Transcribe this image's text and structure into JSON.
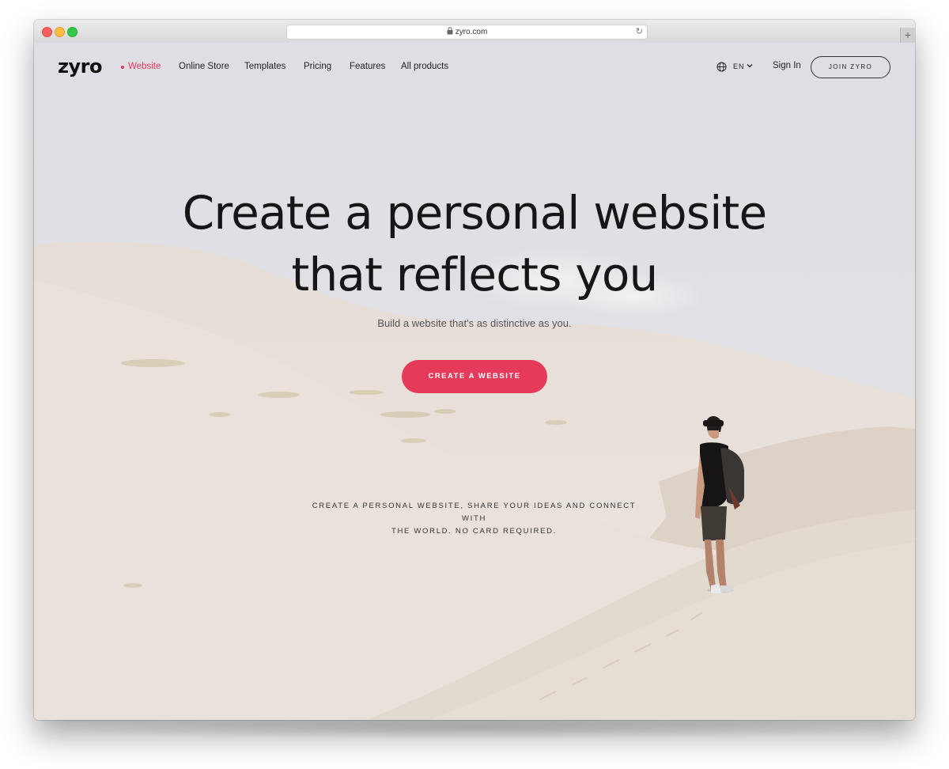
{
  "browser": {
    "url": "zyro.com",
    "new_tab_label": "+"
  },
  "nav": {
    "logo": "zyro",
    "links": [
      "Website",
      "Online Store",
      "Templates",
      "Pricing",
      "Features",
      "All products"
    ],
    "language": "EN",
    "sign_in": "Sign In",
    "join": "JOIN ZYRO"
  },
  "hero": {
    "title_line1": "Create a personal website",
    "title_line2": "that reflects you",
    "subtitle": "Build a website that's as distinctive as you.",
    "cta": "CREATE A WEBSITE",
    "tagline_line1": "CREATE A PERSONAL WEBSITE, SHARE YOUR IDEAS AND CONNECT WITH",
    "tagline_line2": "THE WORLD. NO CARD REQUIRED."
  },
  "colors": {
    "accent": "#e63a5b",
    "sky": "#dfdfe5",
    "sand": "#ebe4de"
  }
}
